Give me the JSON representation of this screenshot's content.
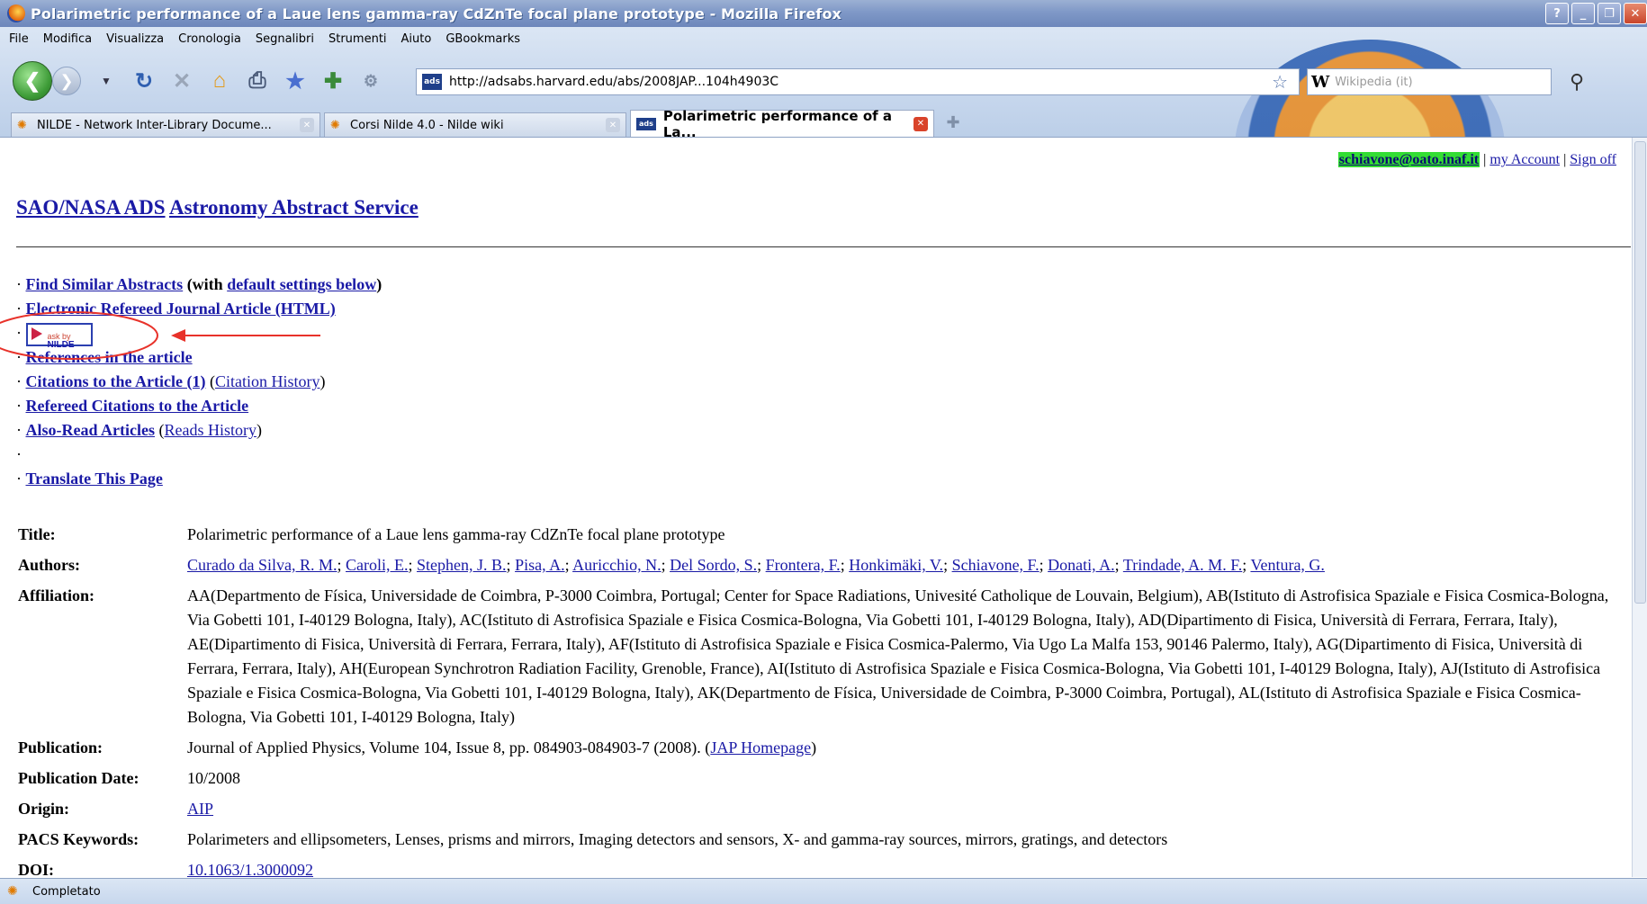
{
  "window": {
    "title": "Polarimetric performance of a Laue lens gamma-ray CdZnTe focal plane prototype - Mozilla Firefox",
    "buttons": [
      "?",
      "_",
      "❐",
      "✕"
    ]
  },
  "menu": [
    "File",
    "Modifica",
    "Visualizza",
    "Cronologia",
    "Segnalibri",
    "Strumenti",
    "Aiuto",
    "GBookmarks"
  ],
  "nav": {
    "url": "http://adsabs.harvard.edu/abs/2008JAP...104h4903C",
    "site_icon_text": "ads",
    "search_placeholder": "Wikipedia (it)",
    "search_engine": "W"
  },
  "tabs": [
    {
      "label": "NILDE - Network Inter-Library Docume...",
      "active": false
    },
    {
      "label": "Corsi Nilde 4.0 - Nilde wiki",
      "active": false
    },
    {
      "label": "Polarimetric performance of a La...",
      "active": true
    }
  ],
  "user": {
    "email": "schiavone@oato.inaf.it",
    "account": "my Account",
    "signoff": "Sign off"
  },
  "header": {
    "ads": "SAO/NASA ADS",
    "service": "Astronomy Abstract Service"
  },
  "links": {
    "find_similar": "Find Similar Abstracts",
    "with_text": "(with",
    "default_settings": "default settings below",
    "with_close": ")",
    "electronic": "Electronic Refereed Journal Article (HTML)",
    "nilde_badge_top": "ask by",
    "nilde_badge_bottom": "NILDE",
    "references": "References in the article",
    "citations": "Citations to the Article (1)",
    "citation_history": "Citation History",
    "refereed_citations": "Refereed Citations to the Article",
    "also_read": "Also-Read Articles",
    "reads_history": "Reads History",
    "translate": "Translate This Page",
    "bullet": "·"
  },
  "meta": {
    "title_label": "Title:",
    "title": "Polarimetric performance of a Laue lens gamma-ray CdZnTe focal plane prototype",
    "authors_label": "Authors:",
    "authors": [
      "Curado da Silva, R. M.",
      "Caroli, E.",
      "Stephen, J. B.",
      "Pisa, A.",
      "Auricchio, N.",
      "Del Sordo, S.",
      "Frontera, F.",
      "Honkimäki, V.",
      "Schiavone, F.",
      "Donati, A.",
      "Trindade, A. M. F.",
      "Ventura, G."
    ],
    "affiliation_label": "Affiliation:",
    "affiliation": "AA(Departmento de Física, Universidade de Coimbra, P-3000 Coimbra, Portugal; Center for Space Radiations, Univesité Catholique de Louvain, Belgium), AB(Istituto di Astrofisica Spaziale e Fisica Cosmica-Bologna, Via Gobetti 101, I-40129 Bologna, Italy), AC(Istituto di Astrofisica Spaziale e Fisica Cosmica-Bologna, Via Gobetti 101, I-40129 Bologna, Italy), AD(Dipartimento di Fisica, Università di Ferrara, Ferrara, Italy), AE(Dipartimento di Fisica, Università di Ferrara, Ferrara, Italy), AF(Istituto di Astrofisica Spaziale e Fisica Cosmica-Palermo, Via Ugo La Malfa 153, 90146 Palermo, Italy), AG(Dipartimento di Fisica, Università di Ferrara, Ferrara, Italy), AH(European Synchrotron Radiation Facility, Grenoble, France), AI(Istituto di Astrofisica Spaziale e Fisica Cosmica-Bologna, Via Gobetti 101, I-40129 Bologna, Italy), AJ(Istituto di Astrofisica Spaziale e Fisica Cosmica-Bologna, Via Gobetti 101, I-40129 Bologna, Italy), AK(Departmento de Física, Universidade de Coimbra, P-3000 Coimbra, Portugal), AL(Istituto di Astrofisica Spaziale e Fisica Cosmica-Bologna, Via Gobetti 101, I-40129 Bologna, Italy)",
    "publication_label": "Publication:",
    "publication": "Journal of Applied Physics, Volume 104, Issue 8, pp. 084903-084903-7 (2008). (",
    "jap_homepage": "JAP Homepage",
    "publication_close": ")",
    "pubdate_label": "Publication Date:",
    "pubdate": "10/2008",
    "origin_label": "Origin:",
    "origin": "AIP",
    "pacs_label": "PACS Keywords:",
    "pacs": "Polarimeters and ellipsometers, Lenses, prisms and mirrors, Imaging detectors and sensors, X- and gamma-ray sources, mirrors, gratings, and detectors",
    "doi_label": "DOI:",
    "doi": "10.1063/1.3000092"
  },
  "status": {
    "text": "Completato"
  },
  "colors": {
    "link": "#1a1aa6",
    "email_highlight": "#33dd33",
    "annotation": "#e8322a"
  }
}
